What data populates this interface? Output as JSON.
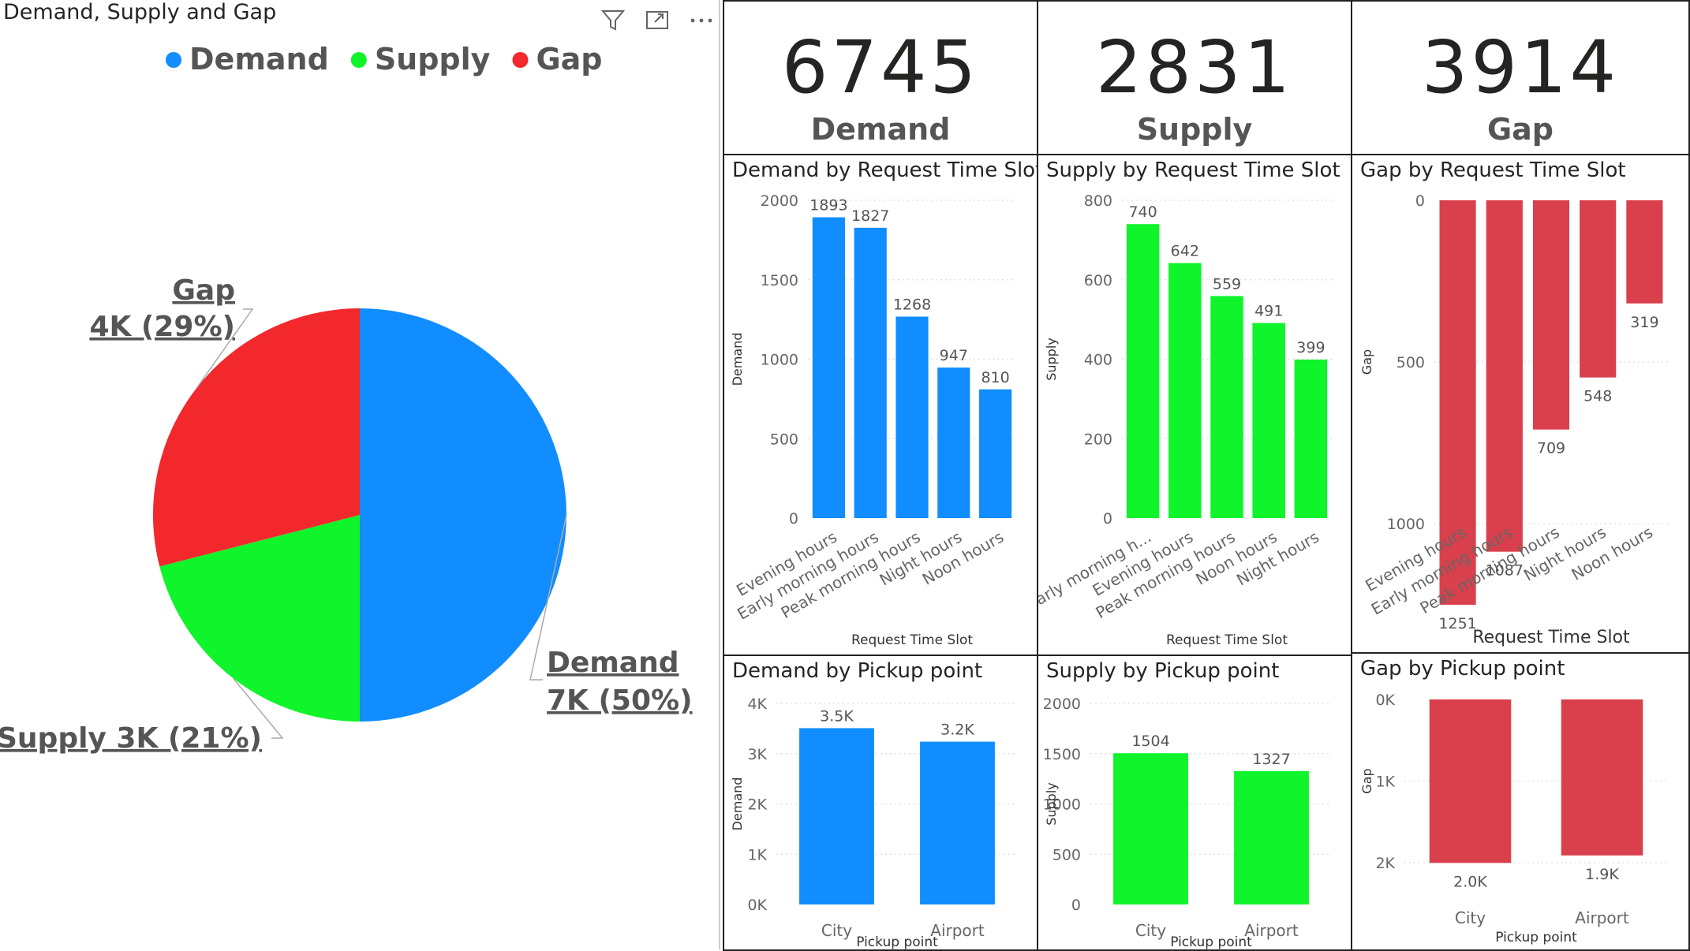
{
  "pie_panel": {
    "title": "Demand, Supply and Gap"
  },
  "cards": [
    {
      "value": "6745",
      "label": "Demand"
    },
    {
      "value": "2831",
      "label": "Supply"
    },
    {
      "value": "3914",
      "label": "Gap"
    }
  ],
  "colors": {
    "demand": "#118DFF",
    "supply": "#0FF42A",
    "gap_pie": "#F2282D",
    "gap_bar": "#D9404B"
  },
  "icons": [
    "filter-icon",
    "focus-mode-icon",
    "more-options-icon"
  ],
  "chart_data": [
    {
      "id": "pie",
      "type": "pie",
      "title": "Demand, Supply and Gap",
      "legend": [
        {
          "name": "Demand",
          "color": "#118DFF"
        },
        {
          "name": "Supply",
          "color": "#0FF42A"
        },
        {
          "name": "Gap",
          "color": "#F2282D"
        }
      ],
      "slices": [
        {
          "name": "Demand",
          "value": 6745,
          "percent": 50,
          "label_line1": "Demand",
          "label_line2": "7K (50%)",
          "color": "#118DFF"
        },
        {
          "name": "Supply",
          "value": 2831,
          "percent": 21,
          "label_line1": "Supply 3K (21%)",
          "label_line2": "",
          "color": "#0FF42A"
        },
        {
          "name": "Gap",
          "value": 3914,
          "percent": 29,
          "label_line1": "Gap",
          "label_line2": "4K (29%)",
          "color": "#F2282D"
        }
      ]
    },
    {
      "id": "demand_slot",
      "type": "bar",
      "title": "Demand by Request Time Slot",
      "xlabel": "Request Time Slot",
      "ylabel": "Demand",
      "ylim": [
        0,
        2000
      ],
      "yticks": [
        "0",
        "500",
        "1000",
        "1500",
        "2000"
      ],
      "ytick_values": [
        0,
        500,
        1000,
        1500,
        2000
      ],
      "categories": [
        "Evening hours",
        "Early morning hours",
        "Peak morning hours",
        "Night hours",
        "Noon hours"
      ],
      "values": [
        1893,
        1827,
        1268,
        947,
        810
      ],
      "labels": [
        "1893",
        "1827",
        "1268",
        "947",
        "810"
      ],
      "color": "#118DFF",
      "inverted": false
    },
    {
      "id": "supply_slot",
      "type": "bar",
      "title": "Supply by Request Time Slot",
      "xlabel": "Request Time Slot",
      "ylabel": "Supply",
      "ylim": [
        0,
        800
      ],
      "yticks": [
        "0",
        "200",
        "400",
        "600",
        "800"
      ],
      "ytick_values": [
        0,
        200,
        400,
        600,
        800
      ],
      "categories": [
        "Early morning h...",
        "Evening hours",
        "Peak morning hours",
        "Noon hours",
        "Night hours"
      ],
      "values": [
        740,
        642,
        559,
        491,
        399
      ],
      "labels": [
        "740",
        "642",
        "559",
        "491",
        "399"
      ],
      "color": "#0FF42A",
      "inverted": false
    },
    {
      "id": "gap_slot",
      "type": "bar",
      "title": "Gap by Request Time Slot",
      "xlabel": "Request Time Slot",
      "ylabel": "Gap",
      "ylim": [
        0,
        1000
      ],
      "yticks": [
        "0",
        "500",
        "1000"
      ],
      "ytick_values": [
        0,
        500,
        1000
      ],
      "categories": [
        "Evening hours",
        "Early morning hours",
        "Peak morning hours",
        "Night hours",
        "Noon hours"
      ],
      "values": [
        1251,
        1087,
        709,
        548,
        319
      ],
      "labels": [
        "1251",
        "1087",
        "709",
        "548",
        "319"
      ],
      "color": "#D9404B",
      "inverted": true
    },
    {
      "id": "demand_pickup",
      "type": "bar",
      "title": "Demand by Pickup point",
      "xlabel": "Pickup point",
      "ylabel": "Demand",
      "ylim": [
        0,
        4000
      ],
      "yticks": [
        "0K",
        "1K",
        "2K",
        "3K",
        "4K"
      ],
      "ytick_values": [
        0,
        1000,
        2000,
        3000,
        4000
      ],
      "categories": [
        "City",
        "Airport"
      ],
      "values": [
        3507,
        3238
      ],
      "labels": [
        "3.5K",
        "3.2K"
      ],
      "color": "#118DFF",
      "inverted": false
    },
    {
      "id": "supply_pickup",
      "type": "bar",
      "title": "Supply by Pickup point",
      "xlabel": "Pickup point",
      "ylabel": "Supply",
      "ylim": [
        0,
        2000
      ],
      "yticks": [
        "0",
        "500",
        "1000",
        "1500",
        "2000"
      ],
      "ytick_values": [
        0,
        500,
        1000,
        1500,
        2000
      ],
      "categories": [
        "City",
        "Airport"
      ],
      "values": [
        1504,
        1327
      ],
      "labels": [
        "1504",
        "1327"
      ],
      "color": "#0FF42A",
      "inverted": false
    },
    {
      "id": "gap_pickup",
      "type": "bar",
      "title": "Gap by Pickup point",
      "xlabel": "Pickup point",
      "ylabel": "Gap",
      "ylim": [
        0,
        2000
      ],
      "yticks": [
        "0K",
        "1K",
        "2K"
      ],
      "ytick_values": [
        0,
        1000,
        2000
      ],
      "categories": [
        "City",
        "Airport"
      ],
      "values": [
        2003,
        1911
      ],
      "labels": [
        "2.0K",
        "1.9K"
      ],
      "color": "#D9404B",
      "inverted": true
    }
  ]
}
